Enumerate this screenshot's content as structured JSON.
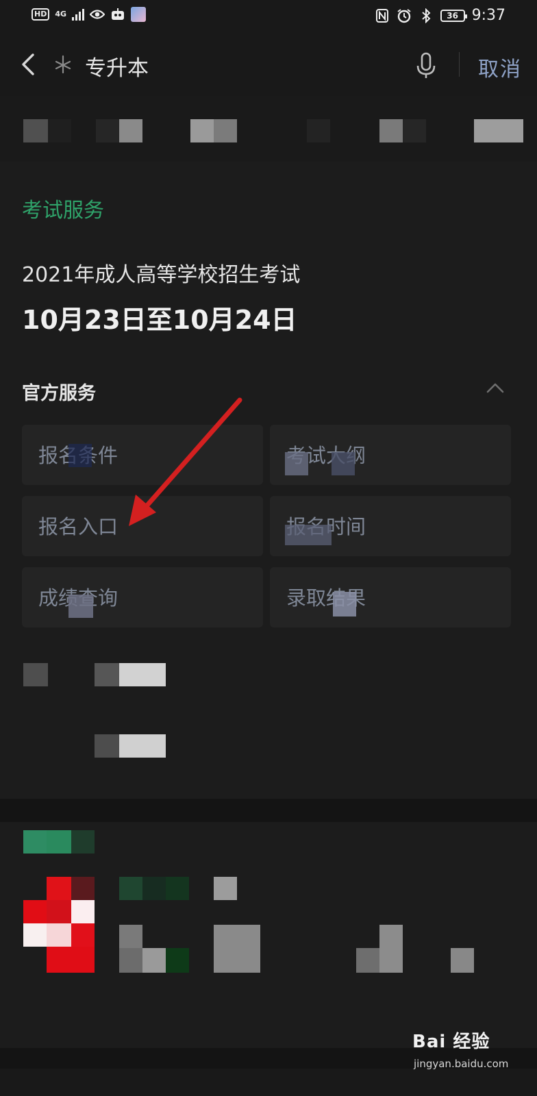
{
  "status_bar": {
    "hd": "HD",
    "network": "4G",
    "battery": "36",
    "time": "9:37"
  },
  "search": {
    "query": "专升本",
    "cancel_label": "取消"
  },
  "exam_card": {
    "section_label": "考试服务",
    "exam_title": "2021年成人高等学校招生考试",
    "exam_date": "10月23日至10月24日",
    "official_label": "官方服务",
    "services": [
      "报名条件",
      "考试大纲",
      "报名入口",
      "报名时间",
      "成绩查询",
      "录取结果"
    ]
  },
  "watermark": {
    "brand": "Bai 经验",
    "url": "jingyan.baidu.com"
  },
  "colors": {
    "background": "#191919",
    "accent_green": "#2fa36a",
    "link_blue": "#8fa3c8",
    "arrow_red": "#d42020"
  }
}
